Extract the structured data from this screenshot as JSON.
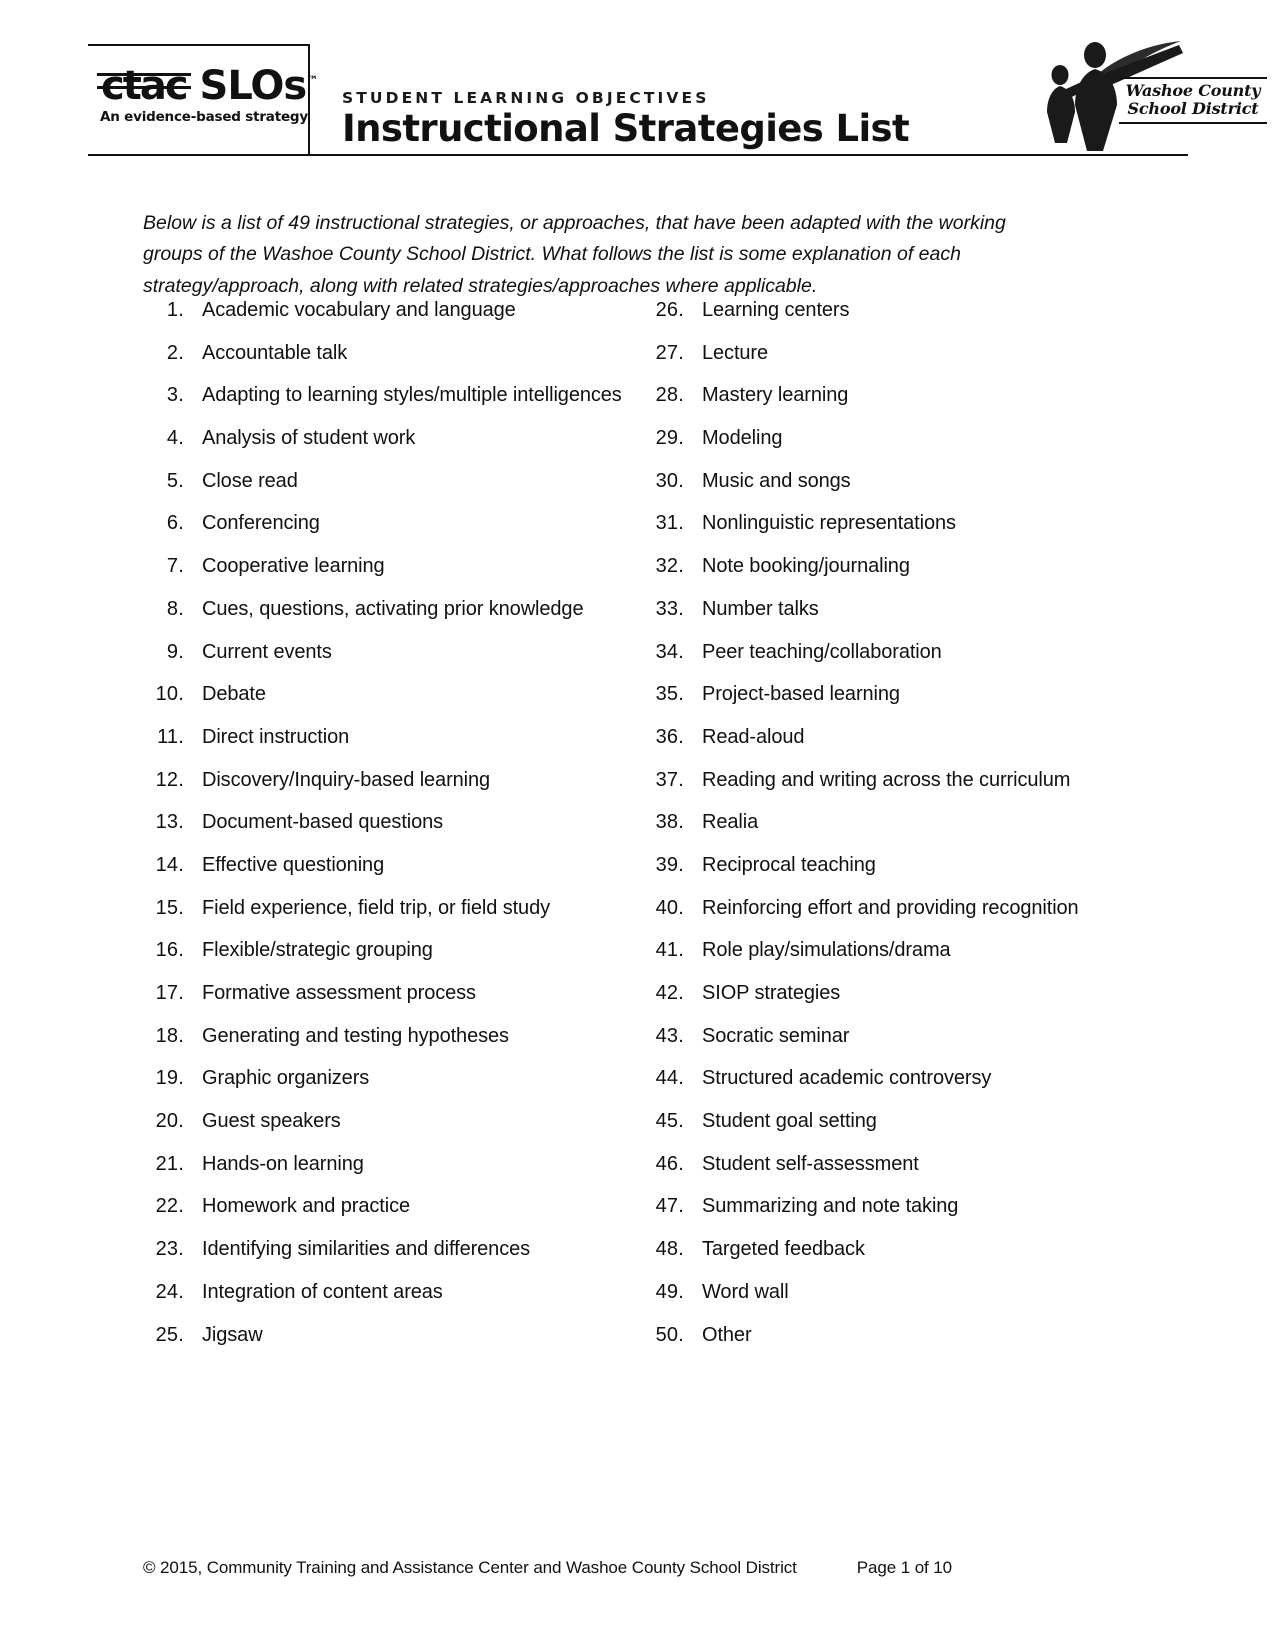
{
  "header": {
    "logo": {
      "ctac_mark": "ctac",
      "slos_mark": "SLOs",
      "trademark": "™",
      "tagline": "An evidence-based strategy"
    },
    "eyebrow": "STUDENT LEARNING OBJECTIVES",
    "title": "Instructional Strategies List",
    "district_logo": {
      "line1": "Washoe County",
      "line2": "School District"
    }
  },
  "intro": "Below is a list of 49 instructional strategies, or approaches, that have been adapted with the working groups of the Washoe County School District. What follows the list is some explanation of each strategy/approach, along with related strategies/approaches where applicable.",
  "list": {
    "left": [
      {
        "num": "1.",
        "label": "Academic vocabulary and language"
      },
      {
        "num": "2.",
        "label": "Accountable talk"
      },
      {
        "num": "3.",
        "label": "Adapting to learning styles/multiple intelligences"
      },
      {
        "num": "4.",
        "label": "Analysis of student work"
      },
      {
        "num": "5.",
        "label": "Close read"
      },
      {
        "num": "6.",
        "label": "Conferencing"
      },
      {
        "num": "7.",
        "label": "Cooperative learning"
      },
      {
        "num": "8.",
        "label": "Cues, questions, activating prior knowledge"
      },
      {
        "num": "9.",
        "label": "Current events"
      },
      {
        "num": "10.",
        "label": "Debate"
      },
      {
        "num": "11.",
        "label": "Direct instruction"
      },
      {
        "num": "12.",
        "label": "Discovery/Inquiry-based learning"
      },
      {
        "num": "13.",
        "label": "Document-based questions"
      },
      {
        "num": "14.",
        "label": "Effective questioning"
      },
      {
        "num": "15.",
        "label": "Field experience, field trip, or field study"
      },
      {
        "num": "16.",
        "label": "Flexible/strategic grouping"
      },
      {
        "num": "17.",
        "label": "Formative assessment process"
      },
      {
        "num": "18.",
        "label": "Generating and testing hypotheses"
      },
      {
        "num": "19.",
        "label": "Graphic organizers"
      },
      {
        "num": "20.",
        "label": "Guest speakers"
      },
      {
        "num": "21.",
        "label": "Hands-on learning"
      },
      {
        "num": "22.",
        "label": "Homework and practice"
      },
      {
        "num": "23.",
        "label": "Identifying similarities and differences"
      },
      {
        "num": "24.",
        "label": "Integration of content areas"
      },
      {
        "num": "25.",
        "label": "Jigsaw"
      }
    ],
    "right": [
      {
        "num": "26.",
        "label": "Learning centers"
      },
      {
        "num": "27.",
        "label": "Lecture"
      },
      {
        "num": "28.",
        "label": "Mastery learning"
      },
      {
        "num": "29.",
        "label": "Modeling"
      },
      {
        "num": "30.",
        "label": "Music and songs"
      },
      {
        "num": "31.",
        "label": "Nonlinguistic representations"
      },
      {
        "num": "32.",
        "label": "Note booking/journaling"
      },
      {
        "num": "33.",
        "label": "Number talks"
      },
      {
        "num": "34.",
        "label": "Peer teaching/collaboration"
      },
      {
        "num": "35.",
        "label": "Project-based learning"
      },
      {
        "num": "36.",
        "label": "Read-aloud"
      },
      {
        "num": "37.",
        "label": "Reading and writing across the curriculum"
      },
      {
        "num": "38.",
        "label": "Realia"
      },
      {
        "num": "39.",
        "label": "Reciprocal teaching"
      },
      {
        "num": "40.",
        "label": "Reinforcing effort and providing recognition"
      },
      {
        "num": "41.",
        "label": "Role play/simulations/drama"
      },
      {
        "num": "42.",
        "label": "SIOP strategies"
      },
      {
        "num": "43.",
        "label": "Socratic seminar"
      },
      {
        "num": "44.",
        "label": "Structured academic controversy"
      },
      {
        "num": "45.",
        "label": "Student goal setting"
      },
      {
        "num": "46.",
        "label": "Student self-assessment"
      },
      {
        "num": "47.",
        "label": "Summarizing and note taking"
      },
      {
        "num": "48.",
        "label": "Targeted feedback"
      },
      {
        "num": "49.",
        "label": "Word wall"
      },
      {
        "num": "50.",
        "label": "Other"
      }
    ]
  },
  "footer": {
    "copyright": "© 2015, Community Training and Assistance Center and Washoe County School District",
    "page": "Page 1 of 10"
  }
}
